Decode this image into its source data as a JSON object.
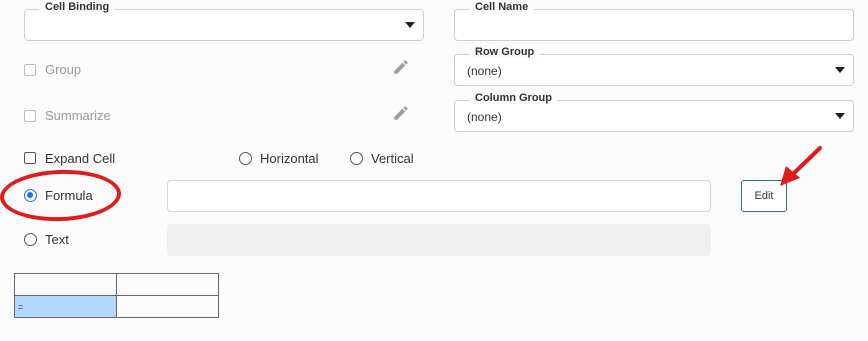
{
  "cell_binding": {
    "legend": "Cell Binding",
    "value": ""
  },
  "cell_name": {
    "legend": "Cell Name",
    "value": ""
  },
  "row_group": {
    "legend": "Row Group",
    "value": "(none)"
  },
  "column_group": {
    "legend": "Column Group",
    "value": "(none)"
  },
  "group": {
    "label": "Group",
    "checked": false,
    "disabled": true
  },
  "summarize": {
    "label": "Summarize",
    "checked": false,
    "disabled": true
  },
  "expand_cell": {
    "label": "Expand Cell",
    "checked": false
  },
  "orientation": {
    "horizontal_label": "Horizontal",
    "vertical_label": "Vertical"
  },
  "formula": {
    "label": "Formula",
    "selected": true,
    "value": "",
    "edit_label": "Edit"
  },
  "text": {
    "label": "Text",
    "selected": false,
    "value": ""
  },
  "preview_table": {
    "rows": [
      [
        "",
        ""
      ],
      [
        "=",
        ""
      ]
    ]
  },
  "annotation_color": "#e01b1b",
  "accent_color": "#1a73e8"
}
